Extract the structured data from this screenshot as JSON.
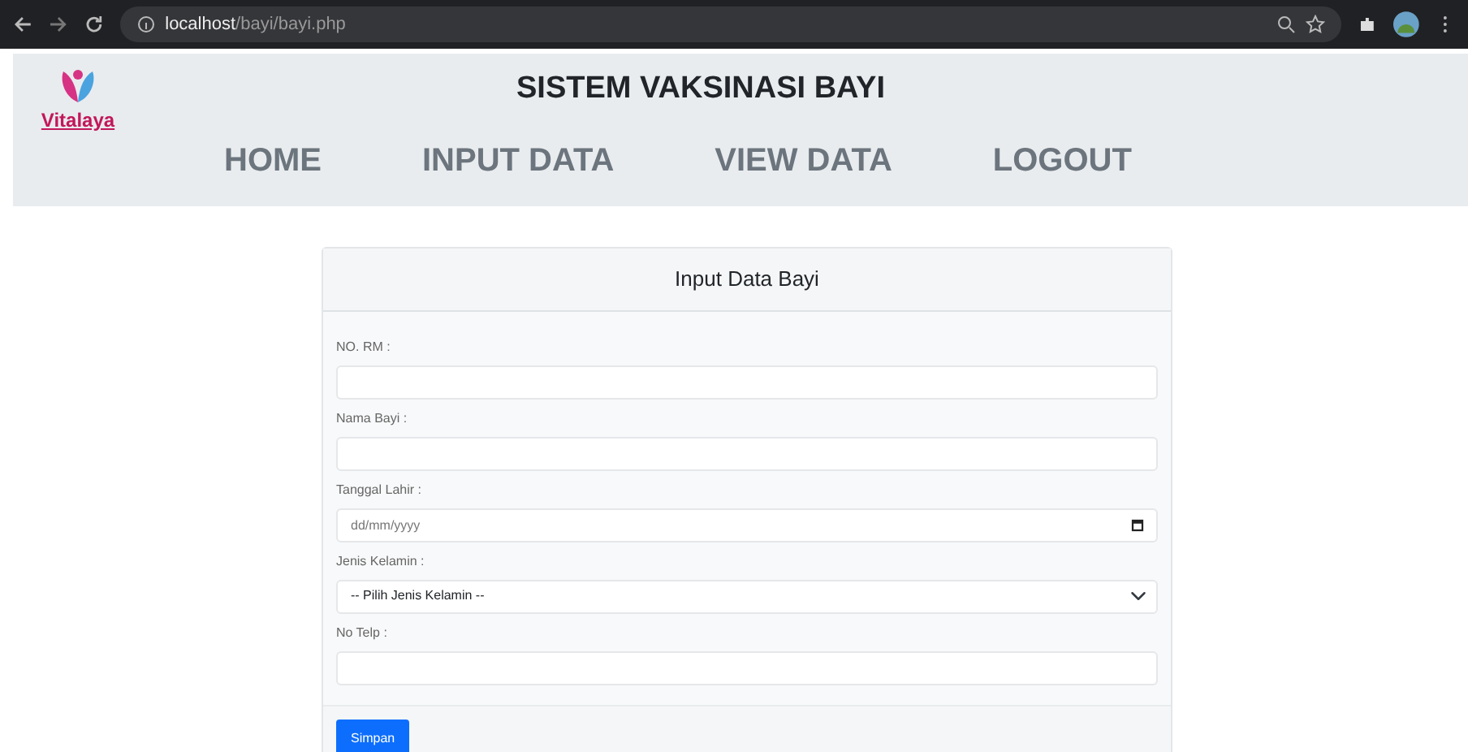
{
  "browser": {
    "url_host": "localhost",
    "url_path": "/bayi/bayi.php"
  },
  "header": {
    "logo_text": "Vitalaya",
    "title": "SISTEM VAKSINASI BAYI",
    "nav": [
      {
        "label": "HOME"
      },
      {
        "label": "INPUT DATA"
      },
      {
        "label": "VIEW DATA"
      },
      {
        "label": "LOGOUT"
      }
    ]
  },
  "form": {
    "title": "Input Data Bayi",
    "fields": [
      {
        "kind": "text",
        "label": "NO. RM :"
      },
      {
        "kind": "text",
        "label": "Nama Bayi :"
      },
      {
        "kind": "date",
        "label": "Tanggal Lahir :",
        "placeholder": "dd/mm/yyyy"
      },
      {
        "kind": "select",
        "label": "Jenis Kelamin :",
        "value": "-- Pilih Jenis Kelamin --"
      },
      {
        "kind": "text",
        "label": "No Telp :"
      }
    ],
    "submit": "Simpan"
  }
}
